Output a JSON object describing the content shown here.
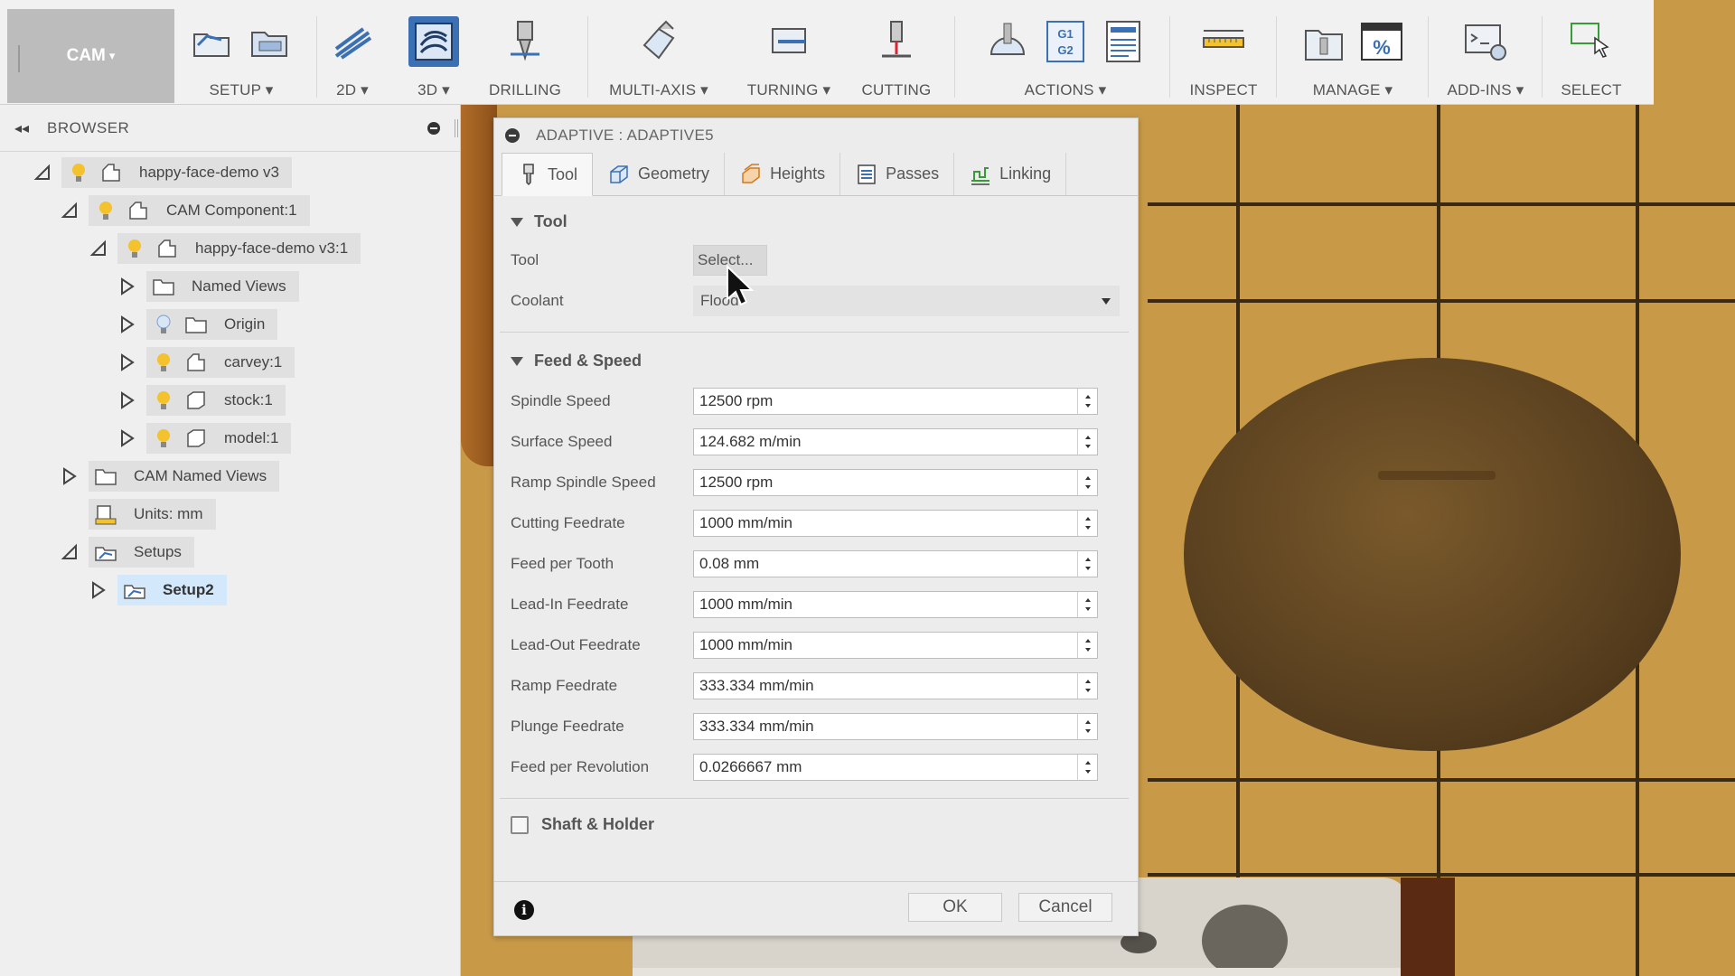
{
  "toolbar": {
    "workspace": "CAM",
    "groups": [
      {
        "id": "setup",
        "label": "SETUP",
        "dropdown": true
      },
      {
        "id": "2d",
        "label": "2D",
        "dropdown": true
      },
      {
        "id": "3d",
        "label": "3D",
        "dropdown": true
      },
      {
        "id": "drilling",
        "label": "DRILLING",
        "dropdown": false
      },
      {
        "id": "multiaxis",
        "label": "MULTI-AXIS",
        "dropdown": true
      },
      {
        "id": "turning",
        "label": "TURNING",
        "dropdown": true
      },
      {
        "id": "cutting",
        "label": "CUTTING",
        "dropdown": false
      },
      {
        "id": "actions",
        "label": "ACTIONS",
        "dropdown": true
      },
      {
        "id": "inspect",
        "label": "INSPECT",
        "dropdown": false
      },
      {
        "id": "manage",
        "label": "MANAGE",
        "dropdown": true
      },
      {
        "id": "addins",
        "label": "ADD-INS",
        "dropdown": true
      },
      {
        "id": "select",
        "label": "SELECT",
        "dropdown": false
      }
    ],
    "dropdown_glyph": "▾",
    "actions_gcode_icon": "G1\nG2",
    "manage_percent_icon": "%"
  },
  "browser": {
    "title": "BROWSER",
    "tree": [
      {
        "label": "happy-face-demo v3"
      },
      {
        "label": "CAM Component:1"
      },
      {
        "label": "happy-face-demo v3:1"
      },
      {
        "label": "Named Views"
      },
      {
        "label": "Origin"
      },
      {
        "label": "carvey:1"
      },
      {
        "label": "stock:1"
      },
      {
        "label": "model:1"
      },
      {
        "label": "CAM Named Views"
      },
      {
        "label": "Units: mm"
      },
      {
        "label": "Setups"
      },
      {
        "label": "Setup2"
      }
    ]
  },
  "dialog": {
    "title": "ADAPTIVE : ADAPTIVE5",
    "tabs": [
      {
        "label": "Tool",
        "icon": "tool-icon"
      },
      {
        "label": "Geometry",
        "icon": "geometry-icon"
      },
      {
        "label": "Heights",
        "icon": "heights-icon"
      },
      {
        "label": "Passes",
        "icon": "passes-icon"
      },
      {
        "label": "Linking",
        "icon": "linking-icon"
      }
    ],
    "tool_section": {
      "title": "Tool",
      "tool_label": "Tool",
      "tool_button": "Select...",
      "coolant_label": "Coolant",
      "coolant_value": "Flood"
    },
    "feed_section": {
      "title": "Feed & Speed",
      "fields": [
        {
          "label": "Spindle Speed",
          "value": "12500 rpm"
        },
        {
          "label": "Surface Speed",
          "value": "124.682 m/min"
        },
        {
          "label": "Ramp Spindle Speed",
          "value": "12500 rpm"
        },
        {
          "label": "Cutting Feedrate",
          "value": "1000 mm/min"
        },
        {
          "label": "Feed per Tooth",
          "value": "0.08 mm"
        },
        {
          "label": "Lead-In Feedrate",
          "value": "1000 mm/min"
        },
        {
          "label": "Lead-Out Feedrate",
          "value": "1000 mm/min"
        },
        {
          "label": "Ramp Feedrate",
          "value": "333.334 mm/min"
        },
        {
          "label": "Plunge Feedrate",
          "value": "333.334 mm/min"
        },
        {
          "label": "Feed per Revolution",
          "value": "0.0266667 mm"
        }
      ]
    },
    "shaft_holder_label": "Shaft & Holder",
    "ok_label": "OK",
    "cancel_label": "Cancel",
    "info_glyph": "i"
  },
  "colors": {
    "accent": "#3b70b5",
    "selection": "#d4e8fb",
    "bulb": "#f3c22c",
    "wood": "#c89a48"
  }
}
